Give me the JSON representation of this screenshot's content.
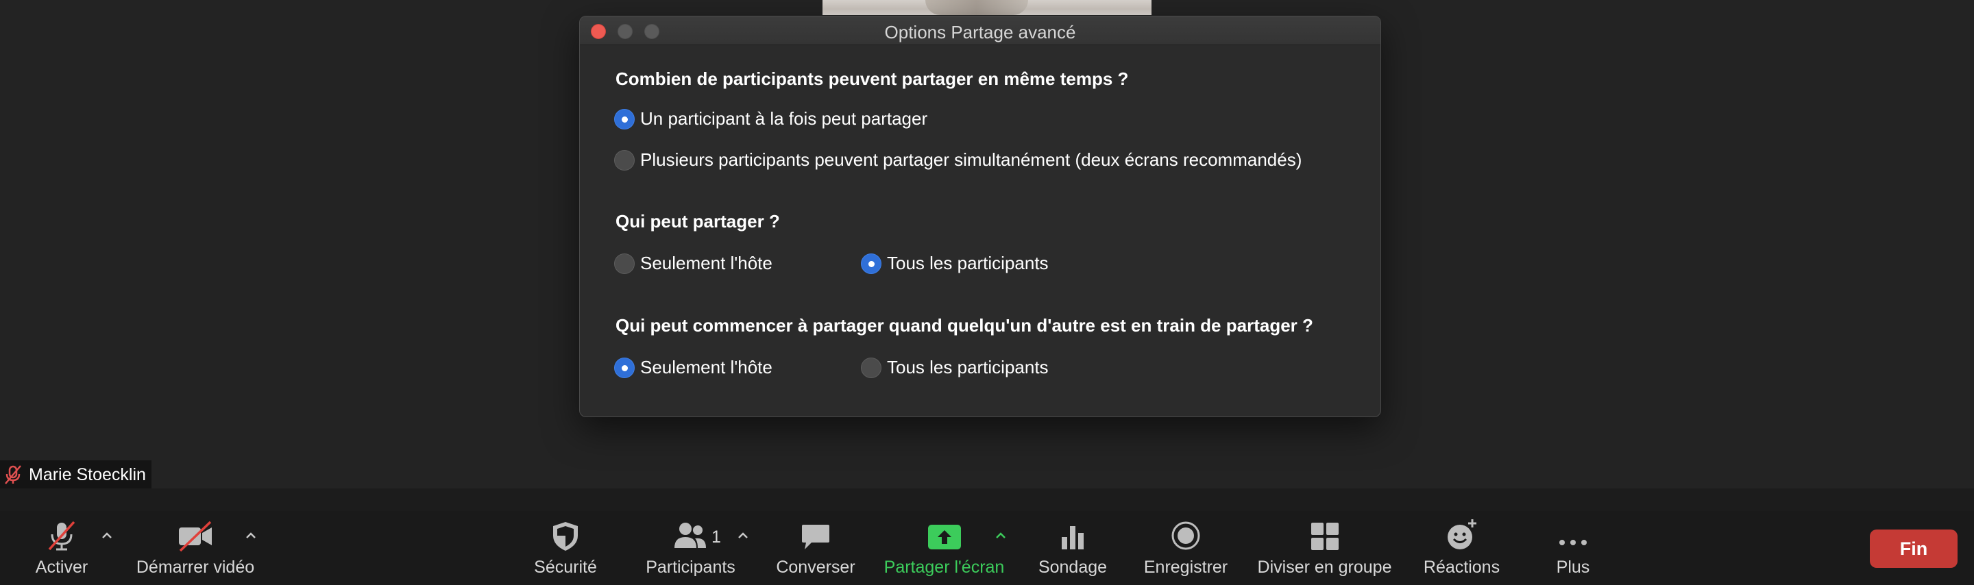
{
  "dialog": {
    "title": "Options Partage avancé",
    "q1": {
      "question": "Combien de participants peuvent partager en même temps ?",
      "options": [
        {
          "label": "Un participant à la fois peut partager",
          "selected": true
        },
        {
          "label": "Plusieurs participants peuvent partager simultanément (deux écrans recommandés)",
          "selected": false
        }
      ]
    },
    "q2": {
      "question": "Qui peut partager ?",
      "options": [
        {
          "label": "Seulement l'hôte",
          "selected": false
        },
        {
          "label": "Tous les participants",
          "selected": true
        }
      ]
    },
    "q3": {
      "question": "Qui peut commencer à partager quand quelqu'un d'autre est en train de partager ?",
      "options": [
        {
          "label": "Seulement l'hôte",
          "selected": true
        },
        {
          "label": "Tous les participants",
          "selected": false
        }
      ]
    }
  },
  "nametag": {
    "name": "Marie Stoecklin",
    "icon": "muted-mic-icon"
  },
  "toolbar": {
    "unmute": {
      "label": "Activer",
      "icon": "muted-mic-icon"
    },
    "video": {
      "label": "Démarrer vidéo",
      "icon": "video-off-icon"
    },
    "security": {
      "label": "Sécurité",
      "icon": "shield-icon"
    },
    "participants": {
      "label": "Participants",
      "count": "1",
      "icon": "participants-icon"
    },
    "chat": {
      "label": "Converser",
      "icon": "chat-bubble-icon"
    },
    "share": {
      "label": "Partager l'écran",
      "icon": "share-screen-icon"
    },
    "poll": {
      "label": "Sondage",
      "icon": "bar-chart-icon"
    },
    "record": {
      "label": "Enregistrer",
      "icon": "record-icon"
    },
    "breakout": {
      "label": "Diviser en groupe",
      "icon": "grid-icon"
    },
    "reactions": {
      "label": "Réactions",
      "icon": "emoji-plus-icon"
    },
    "more": {
      "label": "Plus",
      "icon": "more-dots-icon"
    },
    "end": {
      "label": "Fin"
    }
  },
  "colors": {
    "accent_blue": "#2f6fd8",
    "share_green": "#3ccc5b",
    "end_red": "#c53a35",
    "close_red": "#ee5a52"
  }
}
